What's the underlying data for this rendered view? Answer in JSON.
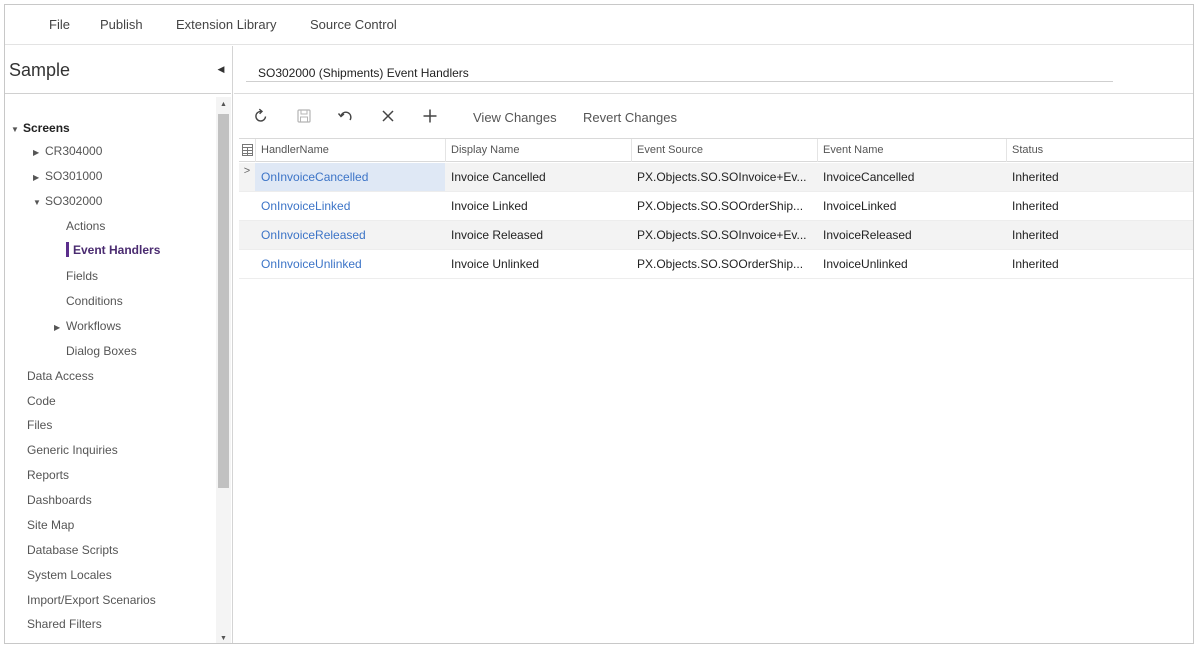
{
  "menu": {
    "items": [
      "File",
      "Publish",
      "Extension Library",
      "Source Control"
    ]
  },
  "project": {
    "title": "Sample"
  },
  "tree": {
    "screens_label": "Screens",
    "screens": [
      "CR304000",
      "SO301000",
      "SO302000"
    ],
    "so302000_children": [
      "Actions",
      "Event Handlers",
      "Fields",
      "Conditions",
      "Workflows",
      "Dialog Boxes"
    ],
    "selected": "Event Handlers",
    "sections": [
      "Data Access",
      "Code",
      "Files",
      "Generic Inquiries",
      "Reports",
      "Dashboards",
      "Site Map",
      "Database Scripts",
      "System Locales",
      "Import/Export Scenarios",
      "Shared Filters"
    ]
  },
  "page": {
    "title": "SO302000 (Shipments) Event Handlers"
  },
  "toolbar": {
    "icons": [
      "refresh-icon",
      "save-icon",
      "undo-icon",
      "delete-icon",
      "add-icon"
    ],
    "view_changes": "View Changes",
    "revert_changes": "Revert Changes"
  },
  "grid": {
    "columns": [
      "HandlerName",
      "Display Name",
      "Event Source",
      "Event Name",
      "Status"
    ],
    "rows": [
      [
        "OnInvoiceCancelled",
        "Invoice Cancelled",
        "PX.Objects.SO.SOInvoice+Ev...",
        "InvoiceCancelled",
        "Inherited"
      ],
      [
        "OnInvoiceLinked",
        "Invoice Linked",
        "PX.Objects.SO.SOOrderShip...",
        "InvoiceLinked",
        "Inherited"
      ],
      [
        "OnInvoiceReleased",
        "Invoice Released",
        "PX.Objects.SO.SOInvoice+Ev...",
        "InvoiceReleased",
        "Inherited"
      ],
      [
        "OnInvoiceUnlinked",
        "Invoice Unlinked",
        "PX.Objects.SO.SOOrderShip...",
        "InvoiceUnlinked",
        "Inherited"
      ]
    ]
  },
  "colors": {
    "link": "#3c74c7",
    "selected_accent": "#5b2e8c",
    "active_cell": "#dfe8f5"
  }
}
